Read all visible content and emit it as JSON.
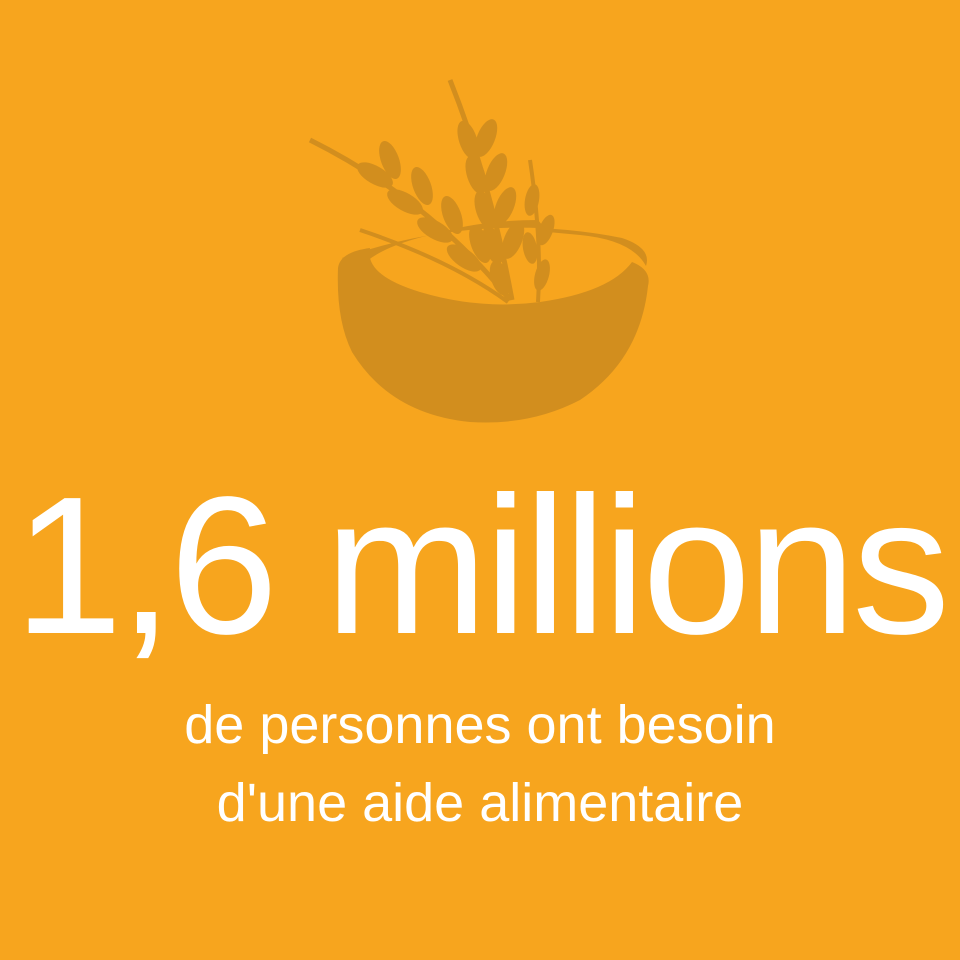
{
  "colors": {
    "background": "#F7A51E",
    "icon": "#D28E1E",
    "text": "#FFFFFF"
  },
  "icon": {
    "name": "wheat-bowl-icon"
  },
  "headline": "1,6 millions",
  "subtitle": {
    "line1": "de personnes ont besoin",
    "line2": "d'une aide alimentaire"
  }
}
